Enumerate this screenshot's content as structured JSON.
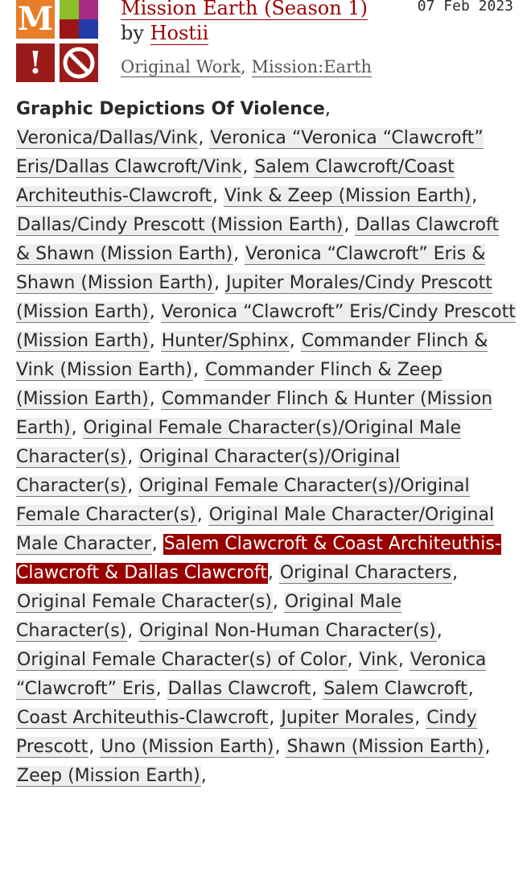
{
  "work": {
    "title": "Mission Earth (Season 1)",
    "by_label": "by",
    "author": "Hostii",
    "date": "07 Feb 2023",
    "fandoms": [
      "Original Work",
      "Mission:Earth"
    ],
    "required_tags": {
      "rating_letter": "M",
      "warning_symbol": "!",
      "icon_names": [
        "rating-mature-icon",
        "category-multi-icon",
        "warning-icon",
        "complete-status-icon"
      ]
    }
  },
  "tags": {
    "warning_label": "Graphic Depictions Of Violence",
    "items": [
      "Veronica/Dallas/Vink",
      "Veronica “Veronica “Clawcroft” Eris/Dallas Clawcroft/Vink",
      "Salem Clawcroft/Coast Architeuthis-Clawcroft",
      "Vink & Zeep (Mission Earth)",
      "Dallas/Cindy Prescott (Mission Earth)",
      "Dallas Clawcroft & Shawn (Mission Earth)",
      "Veronica “Clawcroft” Eris & Shawn (Mission Earth)",
      "Jupiter Morales/Cindy Prescott (Mission Earth)",
      "Veronica “Clawcroft” Eris/Cindy Prescott (Mission Earth)",
      "Hunter/Sphinx",
      "Commander Flinch & Vink (Mission Earth)",
      "Commander Flinch & Zeep (Mission Earth)",
      "Commander Flinch & Hunter (Mission Earth)",
      "Original Female Character(s)/Original Male Character(s)",
      "Original Character(s)/Original Character(s)",
      "Original Female Character(s)/Original Female Character(s)",
      "Original Male Character/Original Male Character",
      "Salem Clawcroft & Coast Architeuthis-Clawcroft & Dallas Clawcroft",
      "Original Characters",
      "Original Female Character(s)",
      "Original Male Character(s)",
      "Original Non-Human Character(s)",
      "Original Female Character(s) of Color",
      "Vink",
      "Veronica “Clawcroft” Eris",
      "Dallas Clawcroft",
      "Salem Clawcroft",
      "Coast Architeuthis-Clawcroft",
      "Jupiter Morales",
      "Cindy Prescott",
      "Uno (Mission Earth)",
      "Shawn (Mission Earth)",
      "Zeep (Mission Earth)"
    ],
    "separator": ",",
    "highlighted_index": 17
  },
  "colors": {
    "link": "#990000",
    "tag_bg": "#eeeeee",
    "highlight_bg": "#990000"
  }
}
